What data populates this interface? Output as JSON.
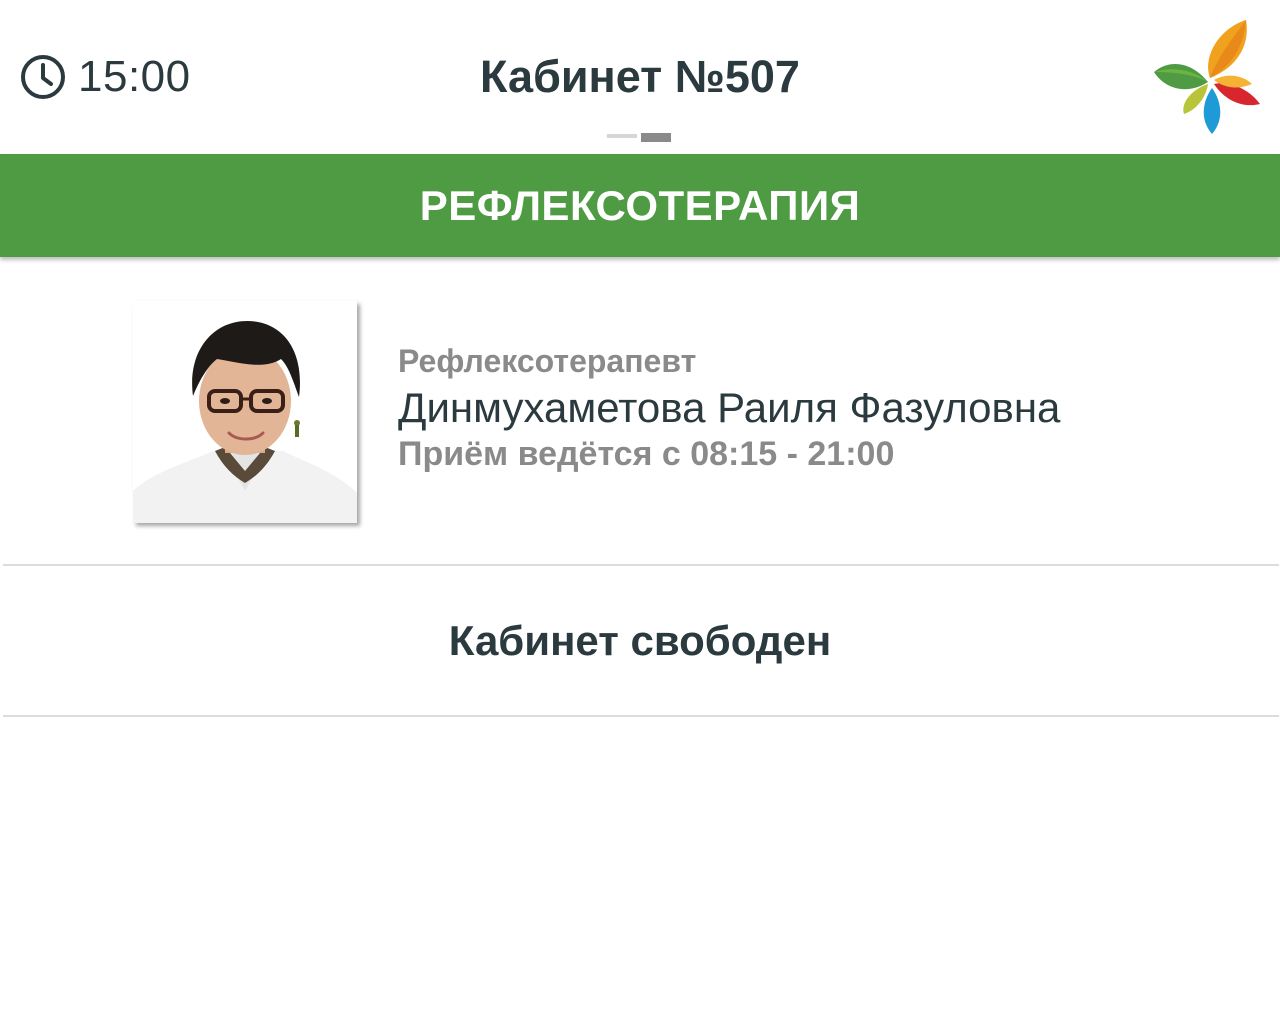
{
  "header": {
    "clock_icon": "clock-icon",
    "time": "15:00",
    "room_title": "Кабинет №507",
    "logo_icon": "butterfly-logo-icon",
    "pager": {
      "count": 2,
      "active_index": 1
    }
  },
  "banner": {
    "specialty": "РЕФЛЕКСОТЕРАПИЯ",
    "color": "#4e9b44"
  },
  "doctor": {
    "role": "Рефлексотерапевт",
    "name": "Динмухаметова Раиля Фазуловна",
    "hours": "Приём ведётся с 08:15 - 21:00"
  },
  "status": {
    "text": "Кабинет свободен"
  }
}
